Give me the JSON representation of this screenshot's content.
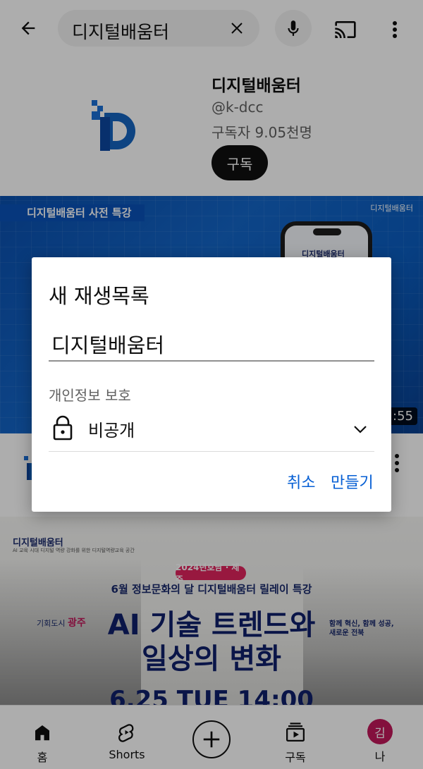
{
  "search": {
    "query": "디지털배움터"
  },
  "channel": {
    "name": "디지털배움터",
    "handle": "@k-dcc",
    "subscribers": "구독자 9.05천명",
    "subscribe_label": "구독"
  },
  "banner": {
    "title": "디지털배움터 사전 특강",
    "brand": "디지털배움터",
    "phone_text": "디지털배움터",
    "duration": ":55"
  },
  "thumb2": {
    "tag": "디지털배움터",
    "tag_sub": "AI 교육 시대 디지털 역량 강화를 위한 디지털역량교육 공간",
    "pill": "2024년호남 · 제주",
    "subtitle": "6월 정보문화의 달 디지털배움터 릴레이 특강",
    "left_line": "기회도시",
    "left_city": "광주",
    "right_line1": "함께 혁신, 함께 성공,",
    "right_line2": "새로운 전북",
    "headline1": "AI 기술 트렌드와",
    "headline2": "일상의 변화",
    "date": "6.25 TUE 14:00"
  },
  "dialog": {
    "title": "새 재생목록",
    "name_value": "디지털배움터",
    "privacy_label": "개인정보 보호",
    "privacy_value": "비공개",
    "cancel_label": "취소",
    "create_label": "만들기"
  },
  "nav": {
    "home": "홈",
    "shorts": "Shorts",
    "subscriptions": "구독",
    "me": "나",
    "avatar_initial": "김"
  },
  "colors": {
    "accent_link": "#065fd4",
    "avatar_bg": "#c2185b",
    "banner_blue": "#0b5dc0"
  }
}
